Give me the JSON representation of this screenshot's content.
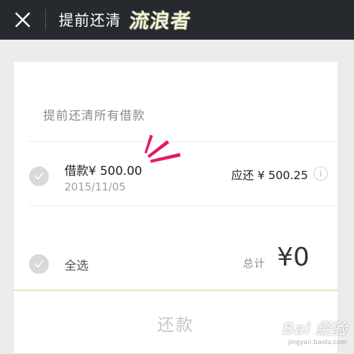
{
  "header": {
    "title": "提前还清",
    "watermark": "流浪者",
    "close_icon": "close-icon",
    "background_color": "#26292d"
  },
  "card": {
    "section_title": "提前还清所有借款",
    "loan": {
      "amount_label": "借款¥ 500.00",
      "date": "2015/11/05",
      "due_label": "应还 ¥ 500.25",
      "info_icon_glyph": "i",
      "checked": false
    },
    "footer": {
      "select_all_label": "全选",
      "total_label": "总计",
      "total_value": "¥0",
      "accent_line_color": "#e8e4b4"
    },
    "repay_button_label": "还款"
  },
  "brand_watermark": {
    "main": "Bai 经验",
    "sub": "jingyan.baidu.com"
  },
  "colors": {
    "accent_pink": "#e8186b",
    "check_gray": "#d9d9d9",
    "button_disabled_text": "#c6c6c6"
  }
}
